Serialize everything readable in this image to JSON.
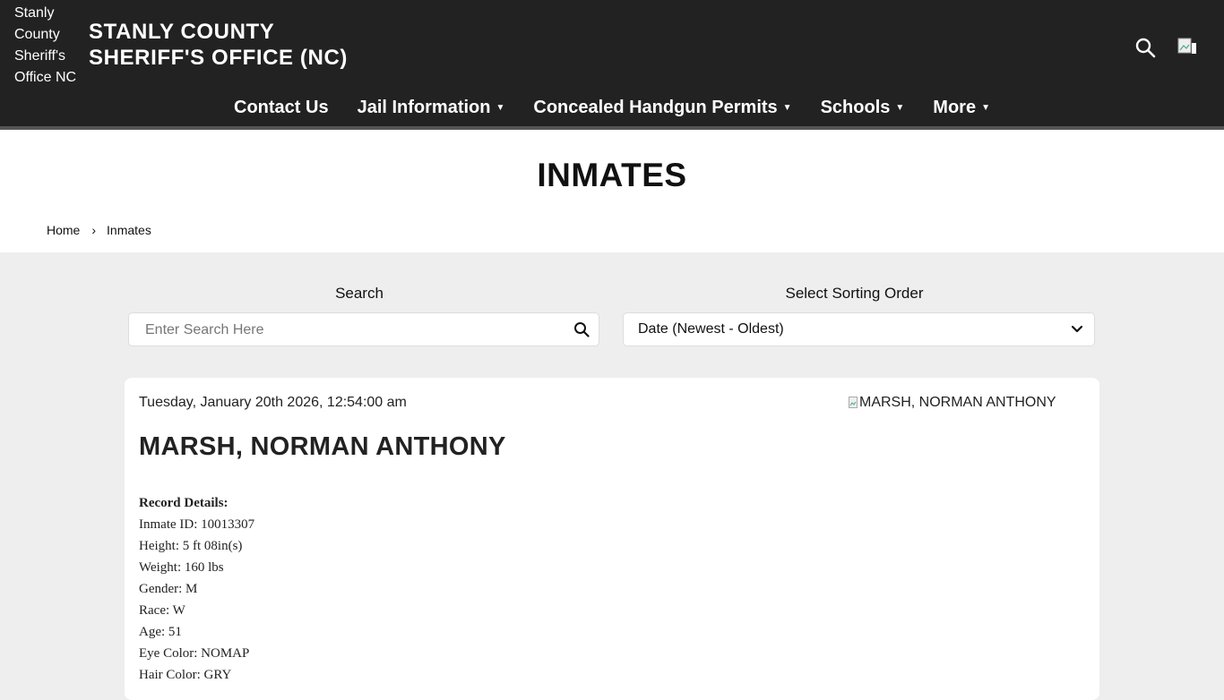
{
  "header": {
    "logo_alt": "Stanly County Sheriff's Office NC",
    "site_title_line1": "STANLY COUNTY",
    "site_title_line2": "SHERIFF'S OFFICE (NC)"
  },
  "nav": {
    "items": [
      {
        "label": "Contact Us",
        "dropdown": false
      },
      {
        "label": "Jail Information",
        "dropdown": true
      },
      {
        "label": "Concealed Handgun Permits",
        "dropdown": true
      },
      {
        "label": "Schools",
        "dropdown": true
      },
      {
        "label": "More",
        "dropdown": true
      }
    ],
    "caret": "▼"
  },
  "page": {
    "title": "INMATES",
    "breadcrumb": {
      "home": "Home",
      "sep": "›",
      "current": "Inmates"
    }
  },
  "controls": {
    "search_label": "Search",
    "search_placeholder": "Enter Search Here",
    "sort_label": "Select Sorting Order",
    "sort_value": "Date (Newest - Oldest)"
  },
  "record": {
    "date": "Tuesday, January 20th 2026, 12:54:00 am",
    "image_alt": "MARSH, NORMAN ANTHONY",
    "name": "MARSH, NORMAN ANTHONY",
    "details_header": "Record Details:",
    "details": [
      "Inmate ID: 10013307",
      "Height: 5 ft 08in(s)",
      "Weight: 160 lbs",
      "Gender: M",
      "Race: W",
      "Age: 51",
      "Eye Color: NOMAP",
      "Hair Color: GRY"
    ]
  },
  "colors": {
    "header_bg": "#222222",
    "page_bg": "#eeeeee",
    "card_bg": "#ffffff"
  },
  "icons": {
    "search": "search-icon",
    "broken_image": "broken-image-icon",
    "chevron": "chevron-down-icon"
  }
}
